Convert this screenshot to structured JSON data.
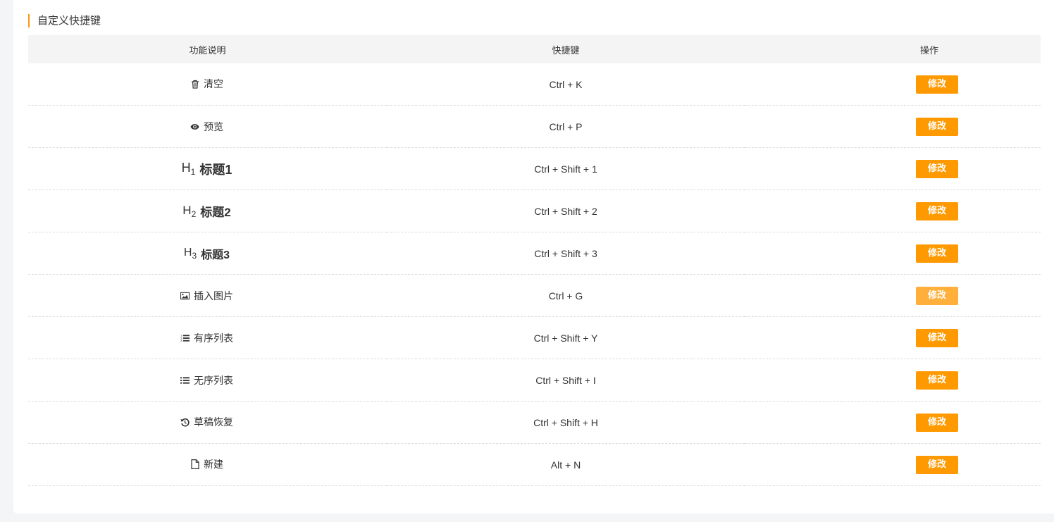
{
  "section": {
    "title": "自定义快捷键"
  },
  "table": {
    "headers": {
      "function": "功能说明",
      "shortcut": "快捷键",
      "action": "操作"
    },
    "rows": [
      {
        "icon": "trash-icon",
        "label": "清空",
        "shortcut": "Ctrl + K",
        "action": "修改"
      },
      {
        "icon": "eye-icon",
        "label": "预览",
        "shortcut": "Ctrl + P",
        "action": "修改"
      },
      {
        "icon": "h1",
        "prefix": "H",
        "sub": "1",
        "label": "标题1",
        "shortcut": "Ctrl + Shift + 1",
        "action": "修改"
      },
      {
        "icon": "h2",
        "prefix": "H",
        "sub": "2",
        "label": "标题2",
        "shortcut": "Ctrl + Shift + 2",
        "action": "修改"
      },
      {
        "icon": "h3",
        "prefix": "H",
        "sub": "3",
        "label": "标题3",
        "shortcut": "Ctrl + Shift + 3",
        "action": "修改"
      },
      {
        "icon": "image-icon",
        "label": "插入图片",
        "shortcut": "Ctrl + G",
        "action": "修改",
        "hover": true
      },
      {
        "icon": "ordered-list-icon",
        "label": "有序列表",
        "shortcut": "Ctrl + Shift + Y",
        "action": "修改"
      },
      {
        "icon": "unordered-list-icon",
        "label": "无序列表",
        "shortcut": "Ctrl + Shift + I",
        "action": "修改"
      },
      {
        "icon": "history-icon",
        "label": "草稿恢复",
        "shortcut": "Ctrl + Shift + H",
        "action": "修改"
      },
      {
        "icon": "file-icon",
        "label": "新建",
        "shortcut": "Alt + N",
        "action": "修改"
      }
    ]
  },
  "colors": {
    "accent": "#ff9900",
    "accent_hover": "#ffaf3a",
    "title_bar": "#f59a0d"
  }
}
